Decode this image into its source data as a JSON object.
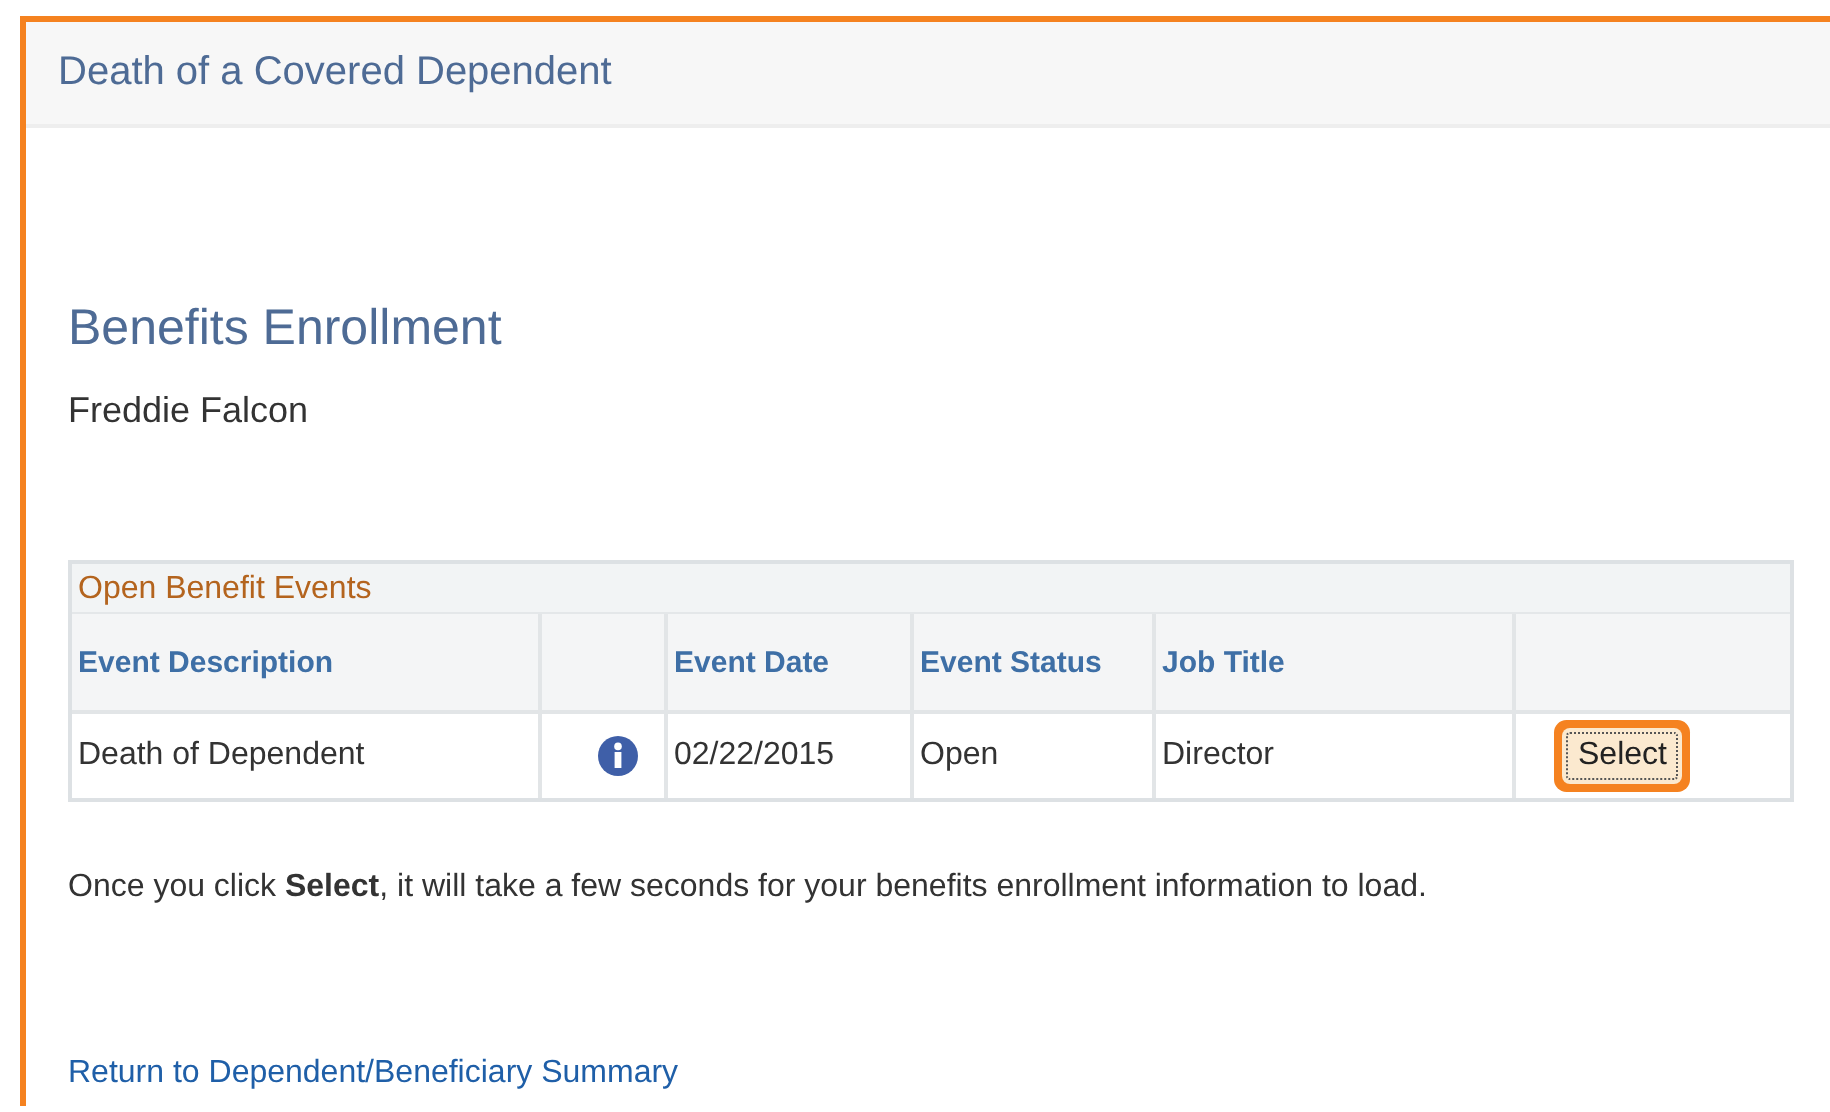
{
  "page_header": {
    "title": "Death of a Covered Dependent"
  },
  "heading": "Benefits Enrollment",
  "employee_name": "Freddie Falcon",
  "events_table": {
    "title": "Open Benefit Events",
    "columns": [
      "Event Description",
      "Event Date",
      "Event Status",
      "Job Title"
    ],
    "rows": [
      {
        "description": "Death of Dependent",
        "date": "02/22/2015",
        "status": "Open",
        "job_title": "Director",
        "button": "Select",
        "highlighted": true
      }
    ]
  },
  "note": "Once you click **Select**, it will take a few seconds for your benefits enrollment information to load.",
  "return_link": "Return to Dependent/Beneficiary Summary"
}
